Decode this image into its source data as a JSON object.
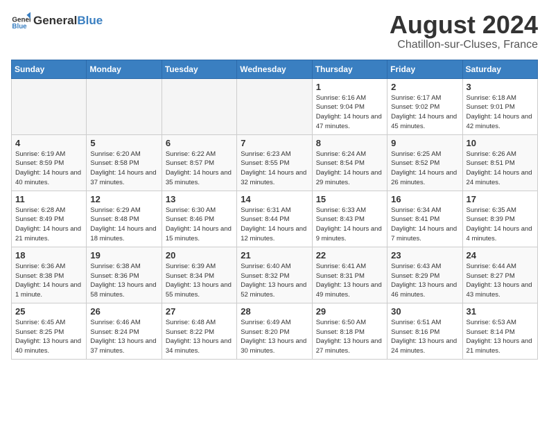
{
  "header": {
    "logo_general": "General",
    "logo_blue": "Blue",
    "month_year": "August 2024",
    "location": "Chatillon-sur-Cluses, France"
  },
  "weekdays": [
    "Sunday",
    "Monday",
    "Tuesday",
    "Wednesday",
    "Thursday",
    "Friday",
    "Saturday"
  ],
  "weeks": [
    [
      {
        "day": "",
        "info": ""
      },
      {
        "day": "",
        "info": ""
      },
      {
        "day": "",
        "info": ""
      },
      {
        "day": "",
        "info": ""
      },
      {
        "day": "1",
        "info": "Sunrise: 6:16 AM\nSunset: 9:04 PM\nDaylight: 14 hours and 47 minutes."
      },
      {
        "day": "2",
        "info": "Sunrise: 6:17 AM\nSunset: 9:02 PM\nDaylight: 14 hours and 45 minutes."
      },
      {
        "day": "3",
        "info": "Sunrise: 6:18 AM\nSunset: 9:01 PM\nDaylight: 14 hours and 42 minutes."
      }
    ],
    [
      {
        "day": "4",
        "info": "Sunrise: 6:19 AM\nSunset: 8:59 PM\nDaylight: 14 hours and 40 minutes."
      },
      {
        "day": "5",
        "info": "Sunrise: 6:20 AM\nSunset: 8:58 PM\nDaylight: 14 hours and 37 minutes."
      },
      {
        "day": "6",
        "info": "Sunrise: 6:22 AM\nSunset: 8:57 PM\nDaylight: 14 hours and 35 minutes."
      },
      {
        "day": "7",
        "info": "Sunrise: 6:23 AM\nSunset: 8:55 PM\nDaylight: 14 hours and 32 minutes."
      },
      {
        "day": "8",
        "info": "Sunrise: 6:24 AM\nSunset: 8:54 PM\nDaylight: 14 hours and 29 minutes."
      },
      {
        "day": "9",
        "info": "Sunrise: 6:25 AM\nSunset: 8:52 PM\nDaylight: 14 hours and 26 minutes."
      },
      {
        "day": "10",
        "info": "Sunrise: 6:26 AM\nSunset: 8:51 PM\nDaylight: 14 hours and 24 minutes."
      }
    ],
    [
      {
        "day": "11",
        "info": "Sunrise: 6:28 AM\nSunset: 8:49 PM\nDaylight: 14 hours and 21 minutes."
      },
      {
        "day": "12",
        "info": "Sunrise: 6:29 AM\nSunset: 8:48 PM\nDaylight: 14 hours and 18 minutes."
      },
      {
        "day": "13",
        "info": "Sunrise: 6:30 AM\nSunset: 8:46 PM\nDaylight: 14 hours and 15 minutes."
      },
      {
        "day": "14",
        "info": "Sunrise: 6:31 AM\nSunset: 8:44 PM\nDaylight: 14 hours and 12 minutes."
      },
      {
        "day": "15",
        "info": "Sunrise: 6:33 AM\nSunset: 8:43 PM\nDaylight: 14 hours and 9 minutes."
      },
      {
        "day": "16",
        "info": "Sunrise: 6:34 AM\nSunset: 8:41 PM\nDaylight: 14 hours and 7 minutes."
      },
      {
        "day": "17",
        "info": "Sunrise: 6:35 AM\nSunset: 8:39 PM\nDaylight: 14 hours and 4 minutes."
      }
    ],
    [
      {
        "day": "18",
        "info": "Sunrise: 6:36 AM\nSunset: 8:38 PM\nDaylight: 14 hours and 1 minute."
      },
      {
        "day": "19",
        "info": "Sunrise: 6:38 AM\nSunset: 8:36 PM\nDaylight: 13 hours and 58 minutes."
      },
      {
        "day": "20",
        "info": "Sunrise: 6:39 AM\nSunset: 8:34 PM\nDaylight: 13 hours and 55 minutes."
      },
      {
        "day": "21",
        "info": "Sunrise: 6:40 AM\nSunset: 8:32 PM\nDaylight: 13 hours and 52 minutes."
      },
      {
        "day": "22",
        "info": "Sunrise: 6:41 AM\nSunset: 8:31 PM\nDaylight: 13 hours and 49 minutes."
      },
      {
        "day": "23",
        "info": "Sunrise: 6:43 AM\nSunset: 8:29 PM\nDaylight: 13 hours and 46 minutes."
      },
      {
        "day": "24",
        "info": "Sunrise: 6:44 AM\nSunset: 8:27 PM\nDaylight: 13 hours and 43 minutes."
      }
    ],
    [
      {
        "day": "25",
        "info": "Sunrise: 6:45 AM\nSunset: 8:25 PM\nDaylight: 13 hours and 40 minutes."
      },
      {
        "day": "26",
        "info": "Sunrise: 6:46 AM\nSunset: 8:24 PM\nDaylight: 13 hours and 37 minutes."
      },
      {
        "day": "27",
        "info": "Sunrise: 6:48 AM\nSunset: 8:22 PM\nDaylight: 13 hours and 34 minutes."
      },
      {
        "day": "28",
        "info": "Sunrise: 6:49 AM\nSunset: 8:20 PM\nDaylight: 13 hours and 30 minutes."
      },
      {
        "day": "29",
        "info": "Sunrise: 6:50 AM\nSunset: 8:18 PM\nDaylight: 13 hours and 27 minutes."
      },
      {
        "day": "30",
        "info": "Sunrise: 6:51 AM\nSunset: 8:16 PM\nDaylight: 13 hours and 24 minutes."
      },
      {
        "day": "31",
        "info": "Sunrise: 6:53 AM\nSunset: 8:14 PM\nDaylight: 13 hours and 21 minutes."
      }
    ]
  ]
}
